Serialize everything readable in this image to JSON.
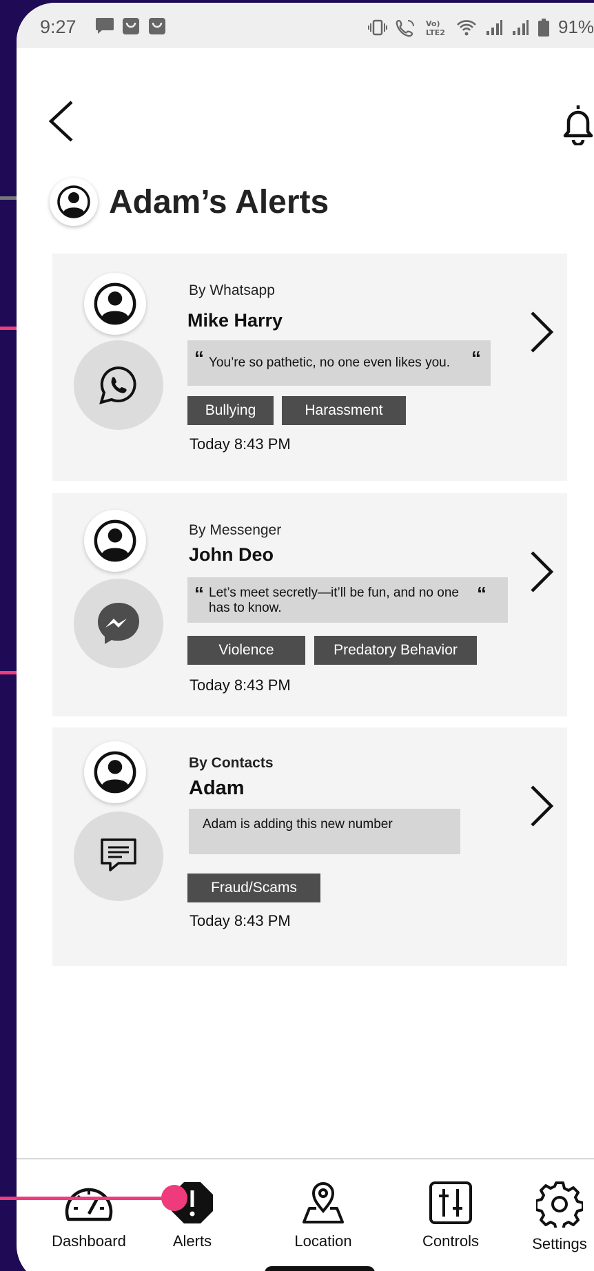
{
  "status_bar": {
    "time": "9:27",
    "battery": "91%"
  },
  "header": {
    "title": "Adam’s Alerts"
  },
  "alerts": [
    {
      "source": "By Whatsapp",
      "name": "Mike Harry",
      "message": "You’re so pathetic, no one even likes you.",
      "tags": [
        "Bullying",
        "Harassment"
      ],
      "time": "Today 8:43 PM",
      "app_icon": "whatsapp-icon"
    },
    {
      "source": "By Messenger",
      "name": "John Deo",
      "message_line1": "Let’s meet secretly—it’ll be fun, and no one",
      "message_line2": "has to know.",
      "tags": [
        "Violence",
        "Predatory Behavior"
      ],
      "time": "Today 8:43 PM",
      "app_icon": "messenger-icon"
    },
    {
      "source": "By Contacts",
      "name": "Adam",
      "message": "Adam is adding this new number",
      "tags": [
        "Fraud/Scams"
      ],
      "time": "Today 8:43 PM",
      "app_icon": "chat-message-icon"
    }
  ],
  "nav": [
    {
      "label": "Dashboard",
      "icon": "gauge-icon"
    },
    {
      "label": "Alerts",
      "icon": "alert-octagon-icon",
      "active": true
    },
    {
      "label": "Location",
      "icon": "location-pin-icon"
    },
    {
      "label": "Controls",
      "icon": "sliders-icon"
    },
    {
      "label": "Settings",
      "icon": "gear-icon"
    }
  ],
  "colors": {
    "background": "#1f0a55",
    "accent": "#ef3b7c",
    "card": "#f4f4f4",
    "tag": "#4d4d4d"
  }
}
